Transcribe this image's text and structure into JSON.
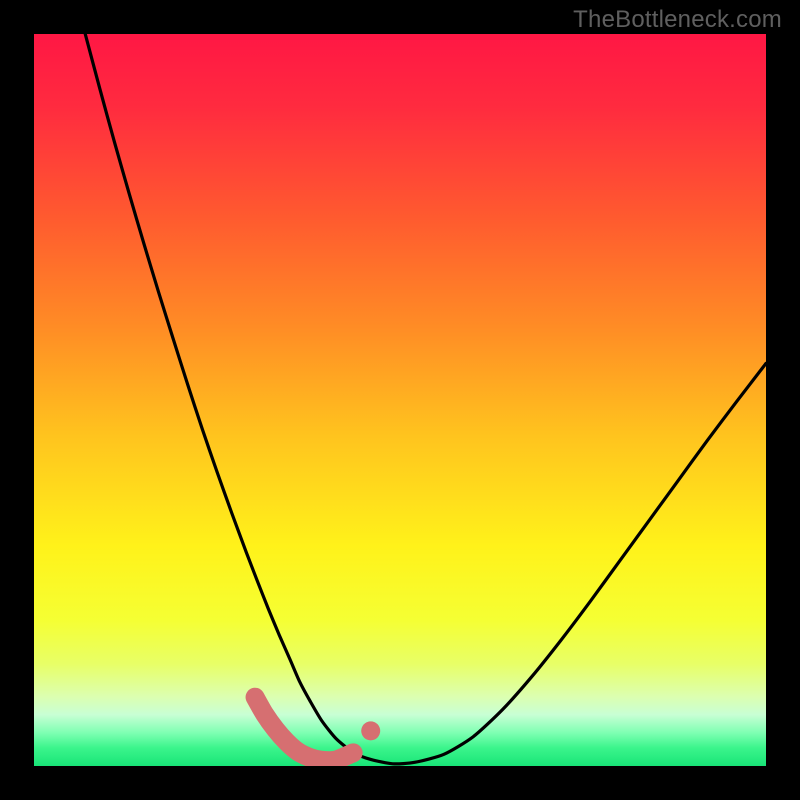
{
  "watermark": "TheBottleneck.com",
  "colors": {
    "frame": "#000000",
    "curve": "#000000",
    "overlay": "#d66f71",
    "gradient_stops": [
      {
        "offset": 0.0,
        "color": "#ff1744"
      },
      {
        "offset": 0.1,
        "color": "#ff2b3f"
      },
      {
        "offset": 0.25,
        "color": "#ff5a2f"
      },
      {
        "offset": 0.4,
        "color": "#ff8c25"
      },
      {
        "offset": 0.55,
        "color": "#ffc41e"
      },
      {
        "offset": 0.7,
        "color": "#fff21a"
      },
      {
        "offset": 0.8,
        "color": "#f5ff33"
      },
      {
        "offset": 0.86,
        "color": "#e8ff66"
      },
      {
        "offset": 0.905,
        "color": "#dcffb0"
      },
      {
        "offset": 0.93,
        "color": "#c8ffd4"
      },
      {
        "offset": 0.955,
        "color": "#7dffb2"
      },
      {
        "offset": 0.975,
        "color": "#3cf58c"
      },
      {
        "offset": 1.0,
        "color": "#18e477"
      }
    ]
  },
  "chart_data": {
    "type": "line",
    "title": "",
    "xlabel": "",
    "ylabel": "",
    "xlim": [
      0,
      100
    ],
    "ylim": [
      0,
      100
    ],
    "series": [
      {
        "name": "bottleneck-curve",
        "x": [
          7,
          9,
          11,
          13,
          15,
          17,
          19,
          21,
          23,
          25,
          27,
          29,
          30.5,
          32,
          33.5,
          35,
          36.3,
          37.7,
          39.3,
          41.3,
          43.7,
          46,
          49,
          52,
          56,
          60,
          64,
          68,
          72,
          76,
          80,
          84,
          88,
          92,
          96,
          100
        ],
        "y": [
          100,
          92.5,
          85.2,
          78.2,
          71.4,
          64.8,
          58.4,
          52.1,
          46.0,
          40.2,
          34.6,
          29.2,
          25.3,
          21.5,
          17.9,
          14.5,
          11.5,
          8.9,
          6.2,
          3.7,
          1.8,
          0.9,
          0.3,
          0.5,
          1.6,
          4.0,
          7.7,
          12.2,
          17.2,
          22.5,
          28.0,
          33.5,
          39.0,
          44.5,
          49.8,
          55.0
        ]
      }
    ],
    "overlay_segment": {
      "name": "highlighted-minimum",
      "x": [
        30.2,
        31.5,
        33,
        34.5,
        36,
        37.6,
        39.2,
        41.2,
        43.6
      ],
      "y": [
        9.4,
        7.1,
        5.0,
        3.3,
        2.0,
        1.2,
        0.8,
        0.8,
        1.8
      ],
      "endpoint": {
        "x": 46.0,
        "y": 4.8
      }
    }
  }
}
